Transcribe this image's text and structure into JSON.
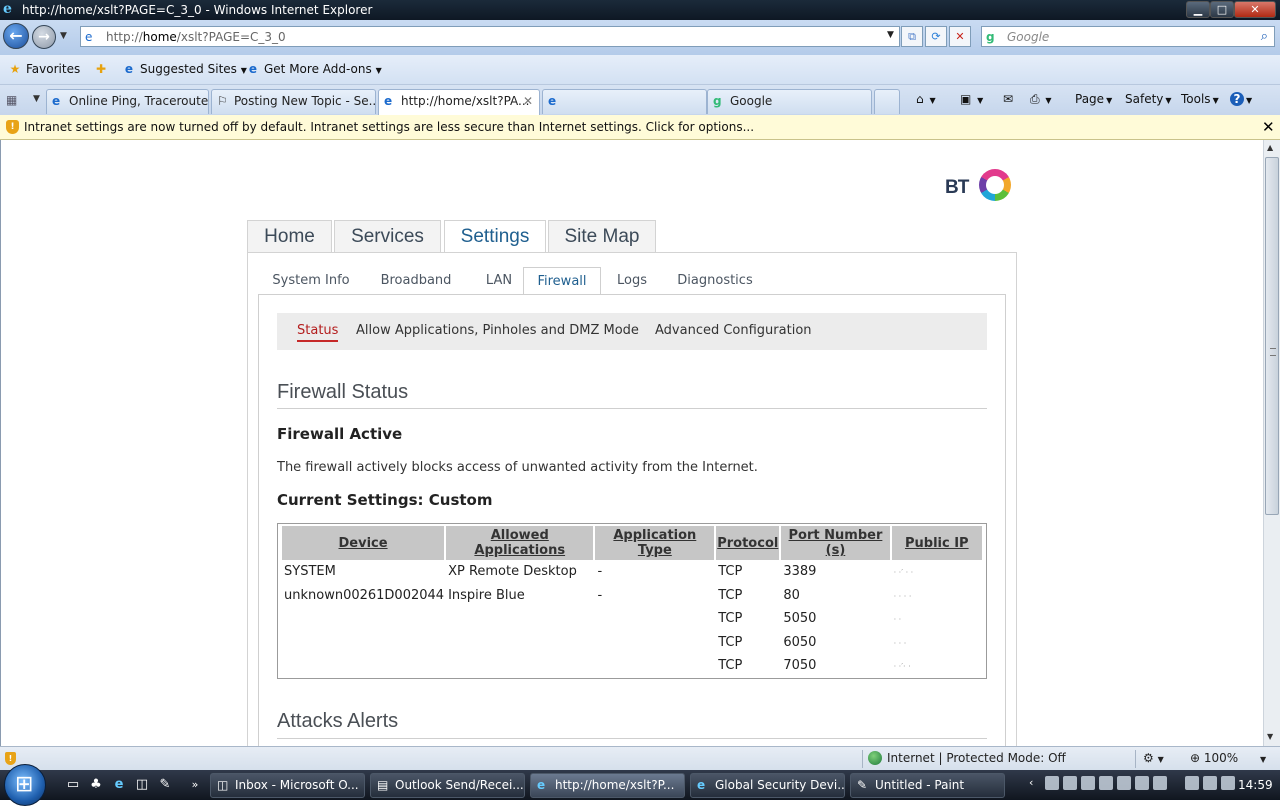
{
  "window": {
    "title": "http://home/xslt?PAGE=C_3_0 - Windows Internet Explorer",
    "min": "▁",
    "max": "□",
    "close": "✕"
  },
  "nav": {
    "back_icon": "←",
    "forward_icon": "→",
    "address_prefix": "http://",
    "address_host": "home",
    "address_rest": "/xslt?PAGE=C_3_0",
    "search_placeholder": "Google"
  },
  "favorites_bar": {
    "favorites": "Favorites",
    "suggested": "Suggested Sites",
    "addons": "Get More Add-ons"
  },
  "tabs": [
    {
      "label": "Online Ping, Traceroute,..."
    },
    {
      "label": "Posting New Topic - Se..."
    },
    {
      "label": "http://home/xslt?PA..."
    },
    {
      "label": ""
    },
    {
      "label": "Google"
    }
  ],
  "commands": {
    "page": "Page",
    "safety": "Safety",
    "tools": "Tools",
    "help": "?"
  },
  "infobar": {
    "message": "Intranet settings are now turned off by default. Intranet settings are less secure than Internet settings. Click for options..."
  },
  "bt": {
    "logo_text": "BT",
    "main_tabs": [
      "Home",
      "Services",
      "Settings",
      "Site Map"
    ],
    "sub_tabs": [
      "System Info",
      "Broadband",
      "LAN",
      "Firewall",
      "Logs",
      "Diagnostics"
    ],
    "section_tabs": [
      "Status",
      "Allow Applications, Pinholes and DMZ Mode",
      "Advanced Configuration"
    ],
    "heading": "Firewall Status",
    "active_title": "Firewall Active",
    "description": "The firewall actively blocks access of unwanted activity from the Internet.",
    "current_settings": "Current Settings: Custom",
    "table": {
      "headers": [
        "Device",
        "Allowed Applications",
        "Application Type",
        "Protocol",
        "Port Number (s)",
        "Public IP"
      ],
      "rows": [
        [
          "SYSTEM",
          "XP Remote Desktop",
          "-",
          "TCP",
          "3389",
          ""
        ],
        [
          "unknown00261D002044",
          "Inspire Blue",
          "-",
          "TCP",
          "80",
          ""
        ],
        [
          "",
          "",
          "",
          "TCP",
          "5050",
          ""
        ],
        [
          "",
          "",
          "",
          "TCP",
          "6050",
          ""
        ],
        [
          "",
          "",
          "",
          "TCP",
          "7050",
          ""
        ]
      ]
    },
    "attacks_heading": "Attacks Alerts"
  },
  "statusbar": {
    "zone": "Internet | Protected Mode: Off",
    "zoom": "100%"
  },
  "taskbar": {
    "buttons": [
      "Inbox - Microsoft O...",
      "Outlook Send/Recei...",
      "http://home/xslt?P...",
      "Global Security Devi...",
      "Untitled - Paint"
    ],
    "clock": "14:59"
  }
}
